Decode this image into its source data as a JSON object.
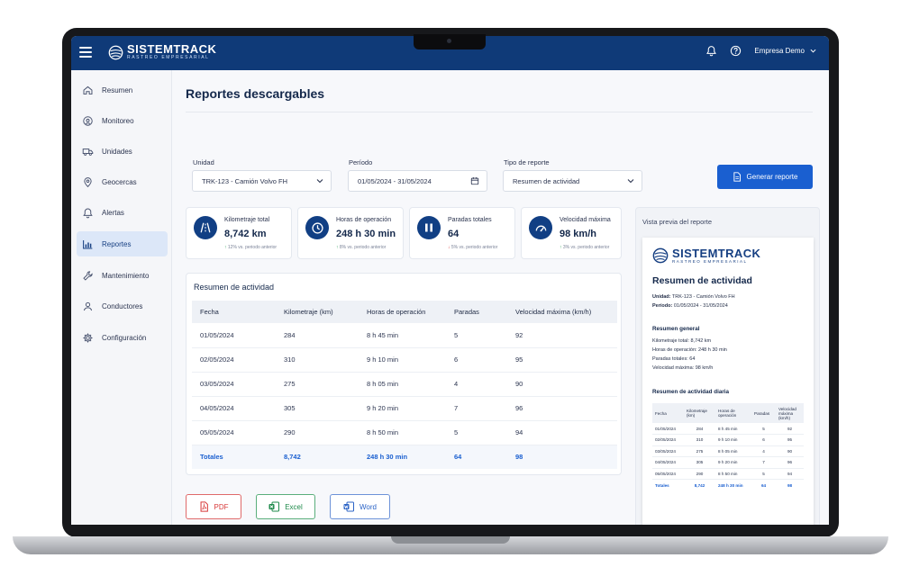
{
  "app": {
    "brand": "SISTEMTRACK",
    "brand_sub": "RASTREO EMPRESARIAL",
    "company": "Empresa Demo"
  },
  "sidebar": {
    "items": [
      {
        "label": "Resumen",
        "icon": "home-icon"
      },
      {
        "label": "Monitoreo",
        "icon": "location-pin-icon"
      },
      {
        "label": "Unidades",
        "icon": "truck-icon"
      },
      {
        "label": "Geocercas",
        "icon": "map-pin-icon"
      },
      {
        "label": "Alertas",
        "icon": "bell-icon"
      },
      {
        "label": "Reportes",
        "icon": "bar-chart-icon",
        "active": true
      },
      {
        "label": "Mantenimiento",
        "icon": "wrench-icon"
      },
      {
        "label": "Conductores",
        "icon": "user-icon"
      },
      {
        "label": "Configuración",
        "icon": "gear-icon"
      }
    ]
  },
  "page": {
    "title": "Reportes descargables"
  },
  "filters": {
    "unit_label": "Unidad",
    "unit_value": "TRK-123 - Camión Volvo FH",
    "period_label": "Período",
    "period_value": "01/05/2024 - 31/05/2024",
    "type_label": "Tipo de reporte",
    "type_value": "Resumen de actividad",
    "generate_label": "Generar reporte"
  },
  "kpis": [
    {
      "label": "Kilometraje total",
      "value": "8,742 km",
      "trend_arrow": "↑",
      "trend_value": "12%",
      "trend_text": "vs. periodo anterior",
      "trend": "up"
    },
    {
      "label": "Horas de operación",
      "value": "248 h 30 min",
      "trend_arrow": "↑",
      "trend_value": "8%",
      "trend_text": "vs. periodo anterior",
      "trend": "up"
    },
    {
      "label": "Paradas totales",
      "value": "64",
      "trend_arrow": "↓",
      "trend_value": "5%",
      "trend_text": "vs. periodo anterior",
      "trend": "down"
    },
    {
      "label": "Velocidad máxima",
      "value": "98 km/h",
      "trend_arrow": "↑",
      "trend_value": "3%",
      "trend_text": "vs. periodo anterior",
      "trend": "up"
    }
  ],
  "summary": {
    "title": "Resumen de actividad",
    "headers": [
      "Fecha",
      "Kilometraje (km)",
      "Horas de operación",
      "Paradas",
      "Velocidad máxima (km/h)"
    ],
    "rows": [
      [
        "01/05/2024",
        "284",
        "8 h 45 min",
        "5",
        "92"
      ],
      [
        "02/05/2024",
        "310",
        "9 h 10 min",
        "6",
        "95"
      ],
      [
        "03/05/2024",
        "275",
        "8 h 05 min",
        "4",
        "90"
      ],
      [
        "04/05/2024",
        "305",
        "9 h 20 min",
        "7",
        "96"
      ],
      [
        "05/05/2024",
        "290",
        "8 h 50 min",
        "5",
        "94"
      ]
    ],
    "totals": [
      "Totales",
      "8,742",
      "248 h 30 min",
      "64",
      "98"
    ]
  },
  "downloads": {
    "pdf": "PDF",
    "excel": "Excel",
    "word": "Word"
  },
  "preview": {
    "title": "Vista previa del reporte",
    "doc_title": "Resumen de actividad",
    "unit_key": "Unidad:",
    "unit_value": "TRK-123 - Camión Volvo FH",
    "period_key": "Período:",
    "period_value": "01/05/2024 - 31/05/2024",
    "general_title": "Resumen general",
    "general_lines": [
      "Kilometraje total: 8,742 km",
      "Horas de operación: 248 h 30 min",
      "Paradas totales: 64",
      "Velocidad máxima: 98 km/h"
    ],
    "daily_title": "Resumen de actividad diaria",
    "headers": [
      "Fecha",
      "Kilometraje (km)",
      "Horas de operación",
      "Paradas",
      "Velocidad máxima (km/h)"
    ]
  },
  "colors": {
    "primary": "#0f3a78",
    "accent": "#1a5fd0",
    "pdf": "#d83a3a",
    "excel": "#1e8a4a",
    "word": "#2b63c6"
  }
}
